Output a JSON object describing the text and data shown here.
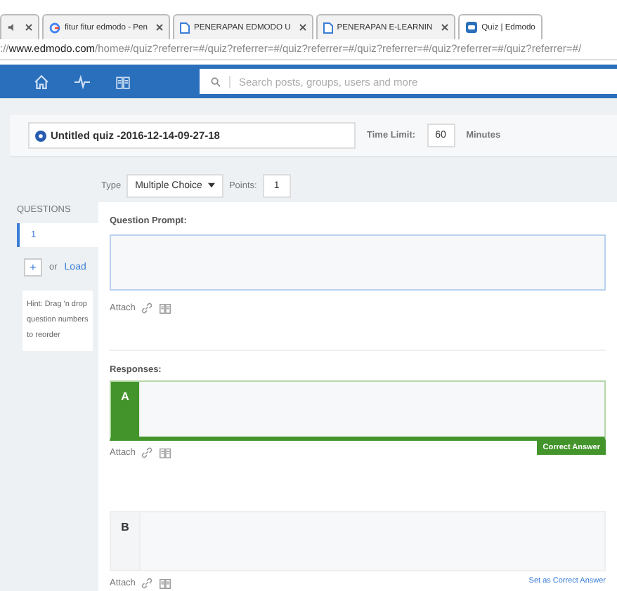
{
  "browser": {
    "tabs": [
      {
        "kind": "audio",
        "selected": false
      },
      {
        "title": "fitur fitur edmodo - Pen",
        "kind": "google",
        "selected": false
      },
      {
        "title": "PENERAPAN EDMODO U",
        "kind": "doc",
        "selected": false
      },
      {
        "title": "PENERAPAN E-LEARNIN",
        "kind": "doc",
        "selected": false
      },
      {
        "title": "Quiz | Edmodo",
        "kind": "edmodo",
        "selected": true
      }
    ],
    "address": {
      "prefix": "://",
      "domain": "www.edmodo.com",
      "path": "/home#/quiz?referrer=#/quiz?referrer=#/quiz?referrer=#/quiz?referrer=#/quiz?referrer=#/quiz?referrer=#/"
    }
  },
  "nav": {
    "search_placeholder": "Search posts, groups, users and more"
  },
  "quiz": {
    "title": "Untitled quiz -2016-12-14-09-27-18",
    "time_limit_label": "Time Limit:",
    "time_limit": "60",
    "minutes_label": "Minutes"
  },
  "sidebar": {
    "heading": "QUESTIONS",
    "questions": [
      {
        "label": "1",
        "selected": true
      }
    ],
    "add": "+",
    "or": "or",
    "load": "Load",
    "hint": "Hint: Drag 'n drop question numbers to reorder"
  },
  "question": {
    "type_label": "Type",
    "type": "Multiple Choice",
    "points_label": "Points:",
    "points": "1",
    "prompt_label": "Question Prompt:",
    "attach": "Attach",
    "responses_label": "Responses:",
    "responses": [
      {
        "letter": "A",
        "correct": true,
        "correct_label": "Correct Answer",
        "attach": "Attach"
      },
      {
        "letter": "B",
        "correct": false,
        "set_label": "Set as Correct Answer",
        "attach": "Attach"
      }
    ]
  }
}
